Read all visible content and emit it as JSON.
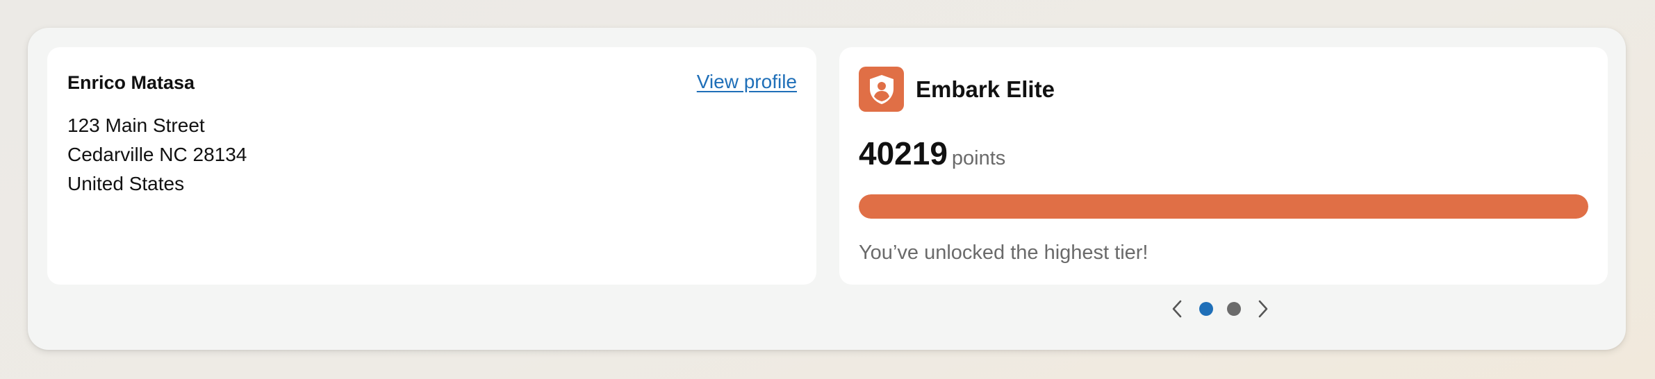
{
  "customer": {
    "name": "Enrico Matasa",
    "view_profile_label": "View profile",
    "address_lines": [
      "123 Main Street",
      "Cedarville NC 28134",
      "United States"
    ]
  },
  "loyalty": {
    "tier_icon": "shield-person-icon",
    "tier_name": "Embark Elite",
    "points": "40219",
    "points_unit": "points",
    "progress_fraction": 1.0,
    "message": "You’ve unlocked the highest tier!"
  },
  "pager": {
    "prev_icon": "chevron-left-icon",
    "next_icon": "chevron-right-icon",
    "page_count": 2,
    "active_page": 1
  },
  "colors": {
    "accent": "#e06f46",
    "link": "#1f6fb8",
    "active_dot": "#1f6fb8",
    "inactive_dot": "#6b6b6b"
  }
}
